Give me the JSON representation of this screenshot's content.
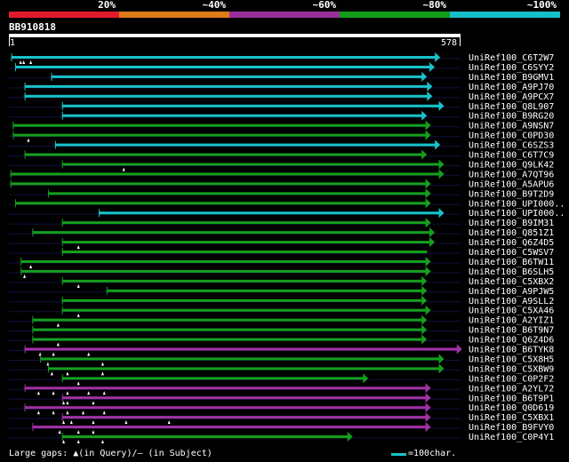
{
  "legend": {
    "segments": [
      {
        "label": "20%",
        "color": "#e11b2d"
      },
      {
        "label": "~40%",
        "color": "#e07b1a"
      },
      {
        "label": "~60%",
        "color": "#9a2f9b"
      },
      {
        "label": "~80%",
        "color": "#129d1a"
      },
      {
        "label": "~100%",
        "color": "#17bfc8"
      }
    ]
  },
  "query": {
    "name": "BB910818",
    "start": "1",
    "end": "578",
    "length": 578
  },
  "footer": {
    "gaps_label": "Large gaps: ▲(in Query)/— (in Subject)",
    "scale_label": "=100char."
  },
  "hits": [
    {
      "label": "UniRef100_C6T2W7",
      "color": "cyan",
      "start": 3,
      "end": 552,
      "arrow": true,
      "gaps_q": [
        15,
        19,
        28
      ]
    },
    {
      "label": "UniRef100_C6SYY2",
      "color": "cyan",
      "start": 8,
      "end": 545,
      "arrow": true,
      "gaps_q": []
    },
    {
      "label": "UniRef100_B9GMV1",
      "color": "cyan",
      "start": 54,
      "end": 535,
      "arrow": true,
      "gaps_q": []
    },
    {
      "label": "UniRef100_A9PJ70",
      "color": "cyan",
      "start": 20,
      "end": 542,
      "arrow": true,
      "gaps_q": []
    },
    {
      "label": "UniRef100_A9PCX7",
      "color": "cyan",
      "start": 20,
      "end": 542,
      "arrow": true,
      "gaps_q": []
    },
    {
      "label": "UniRef100_Q8L907",
      "color": "cyan",
      "start": 68,
      "end": 557,
      "arrow": true,
      "gaps_q": []
    },
    {
      "label": "UniRef100_B9RG20",
      "color": "cyan",
      "start": 68,
      "end": 535,
      "arrow": true,
      "gaps_q": []
    },
    {
      "label": "UniRef100_A9NSN7",
      "color": "green",
      "start": 5,
      "end": 540,
      "arrow": true,
      "gaps_q": []
    },
    {
      "label": "UniRef100_C0PD30",
      "color": "green",
      "start": 5,
      "end": 540,
      "arrow": true,
      "gaps_q": [
        25
      ]
    },
    {
      "label": "UniRef100_C6SZS3",
      "color": "cyan",
      "start": 59,
      "end": 552,
      "arrow": true,
      "gaps_q": []
    },
    {
      "label": "UniRef100_C6T7C9",
      "color": "green",
      "start": 20,
      "end": 535,
      "arrow": true,
      "gaps_q": []
    },
    {
      "label": "UniRef100_Q9LK42",
      "color": "green",
      "start": 68,
      "end": 557,
      "arrow": true,
      "gaps_q": [
        147
      ]
    },
    {
      "label": "UniRef100_A7QT96",
      "color": "green",
      "start": 2,
      "end": 557,
      "arrow": true,
      "gaps_q": []
    },
    {
      "label": "UniRef100_A5APU6",
      "color": "green",
      "start": 2,
      "end": 540,
      "arrow": true,
      "gaps_q": []
    },
    {
      "label": "UniRef100_B9T2D9",
      "color": "green",
      "start": 50,
      "end": 540,
      "arrow": true,
      "gaps_q": []
    },
    {
      "label": "UniRef100_UPI000..",
      "color": "green",
      "start": 8,
      "end": 540,
      "arrow": true,
      "gaps_q": []
    },
    {
      "label": "UniRef100_UPI000..",
      "color": "cyan",
      "start": 115,
      "end": 557,
      "arrow": true,
      "gaps_q": []
    },
    {
      "label": "UniRef100_B9IM31",
      "color": "green",
      "start": 68,
      "end": 540,
      "arrow": true,
      "gaps_q": []
    },
    {
      "label": "UniRef100_Q851Z1",
      "color": "green",
      "start": 30,
      "end": 545,
      "arrow": true,
      "gaps_q": []
    },
    {
      "label": "UniRef100_Q6Z4D5",
      "color": "green",
      "start": 68,
      "end": 545,
      "arrow": true,
      "gaps_q": [
        89
      ]
    },
    {
      "label": "UniRef100_C5WSV7",
      "color": "green",
      "start": 68,
      "end": 535,
      "arrow": false,
      "gaps_q": []
    },
    {
      "label": "UniRef100_B6TW11",
      "color": "green",
      "start": 15,
      "end": 540,
      "arrow": true,
      "gaps_q": [
        28
      ]
    },
    {
      "label": "UniRef100_B6SLH5",
      "color": "green",
      "start": 15,
      "end": 540,
      "arrow": true,
      "gaps_q": [
        20
      ]
    },
    {
      "label": "UniRef100_C5XBX2",
      "color": "green",
      "start": 68,
      "end": 535,
      "arrow": true,
      "gaps_q": [
        89
      ]
    },
    {
      "label": "UniRef100_A9PJW5",
      "color": "green",
      "start": 125,
      "end": 535,
      "arrow": true,
      "gaps_q": []
    },
    {
      "label": "UniRef100_A9SLL2",
      "color": "green",
      "start": 68,
      "end": 535,
      "arrow": true,
      "gaps_q": []
    },
    {
      "label": "UniRef100_C5XA46",
      "color": "green",
      "start": 68,
      "end": 540,
      "arrow": true,
      "gaps_q": [
        89
      ]
    },
    {
      "label": "UniRef100_A2YIZ1",
      "color": "green",
      "start": 30,
      "end": 535,
      "arrow": true,
      "gaps_q": [
        63
      ]
    },
    {
      "label": "UniRef100_B6T9N7",
      "color": "green",
      "start": 30,
      "end": 535,
      "arrow": true,
      "gaps_q": []
    },
    {
      "label": "UniRef100_Q6Z4D6",
      "color": "green",
      "start": 30,
      "end": 535,
      "arrow": true,
      "gaps_q": [
        63
      ]
    },
    {
      "label": "UniRef100_B6TYK8",
      "color": "purple",
      "start": 20,
      "end": 580,
      "arrow": true,
      "gaps_q": [
        40,
        57,
        102
      ]
    },
    {
      "label": "UniRef100_C5X8H5",
      "color": "green",
      "start": 40,
      "end": 557,
      "arrow": true,
      "gaps_q": [
        50,
        120
      ]
    },
    {
      "label": "UniRef100_C5XBW9",
      "color": "green",
      "start": 50,
      "end": 557,
      "arrow": true,
      "gaps_q": [
        55,
        75,
        120
      ]
    },
    {
      "label": "UniRef100_C0P2F2",
      "color": "green",
      "start": 68,
      "end": 460,
      "arrow": true,
      "gaps_q": [
        89
      ]
    },
    {
      "label": "UniRef100_A2YL72",
      "color": "purple",
      "start": 20,
      "end": 540,
      "arrow": true,
      "gaps_q": [
        38,
        57,
        75,
        102,
        122
      ]
    },
    {
      "label": "UniRef100_B6T9P1",
      "color": "purple",
      "start": 68,
      "end": 540,
      "arrow": true,
      "gaps_q": [
        70,
        75,
        108
      ]
    },
    {
      "label": "UniRef100_Q0D619",
      "color": "purple",
      "start": 20,
      "end": 540,
      "arrow": true,
      "gaps_q": [
        38,
        57,
        75,
        95,
        122
      ]
    },
    {
      "label": "UniRef100_C5XBX1",
      "color": "purple",
      "start": 68,
      "end": 540,
      "arrow": true,
      "gaps_q": [
        70,
        80,
        108,
        150,
        205
      ]
    },
    {
      "label": "UniRef100_B9FVY0",
      "color": "purple",
      "start": 30,
      "end": 540,
      "arrow": true,
      "gaps_q": [
        65,
        89,
        108
      ]
    },
    {
      "label": "UniRef100_C0P4Y1",
      "color": "green",
      "start": 68,
      "end": 440,
      "arrow": true,
      "gaps_q": [
        70,
        89,
        120
      ]
    }
  ]
}
